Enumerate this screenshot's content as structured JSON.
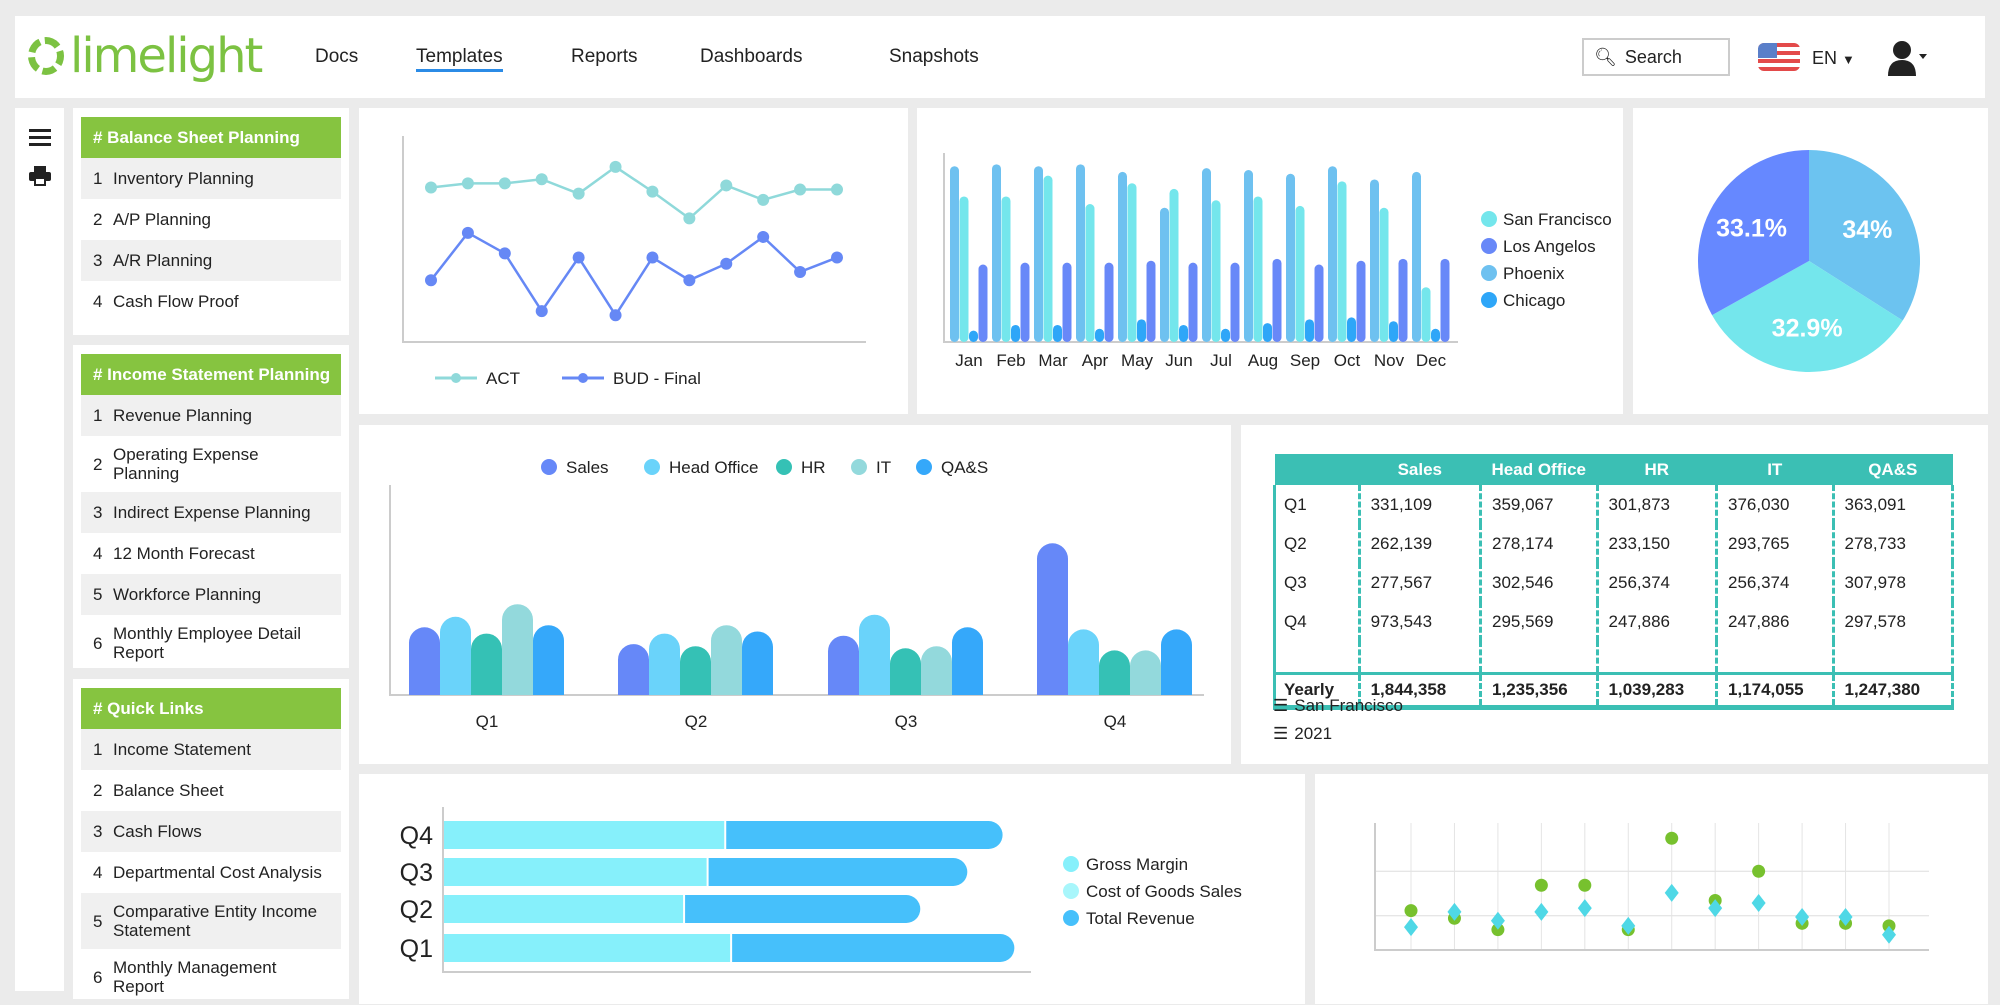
{
  "header": {
    "logo": "limelight",
    "nav": [
      "Docs",
      "Templates",
      "Reports",
      "Dashboards",
      "Snapshots"
    ],
    "active_nav": "Templates",
    "search_placeholder": "Search",
    "language": "EN"
  },
  "sidebar": {
    "panels": [
      {
        "title": "# Balance Sheet Planning",
        "items": [
          {
            "n": "1",
            "label": "Inventory Planning"
          },
          {
            "n": "2",
            "label": "A/P Planning"
          },
          {
            "n": "3",
            "label": "A/R Planning"
          },
          {
            "n": "4",
            "label": "Cash Flow Proof"
          }
        ]
      },
      {
        "title": "# Income Statement Planning",
        "items": [
          {
            "n": "1",
            "label": "Revenue Planning"
          },
          {
            "n": "2",
            "label": "Operating Expense Planning"
          },
          {
            "n": "3",
            "label": "Indirect Expense Planning"
          },
          {
            "n": "4",
            "label": "12 Month Forecast"
          },
          {
            "n": "5",
            "label": "Workforce Planning"
          },
          {
            "n": "6",
            "label": "Monthly Employee Detail Report"
          }
        ]
      },
      {
        "title": "# Quick Links",
        "items": [
          {
            "n": "1",
            "label": "Income Statement"
          },
          {
            "n": "2",
            "label": "Balance Sheet"
          },
          {
            "n": "3",
            "label": "Cash Flows"
          },
          {
            "n": "4",
            "label": "Departmental Cost Analysis"
          },
          {
            "n": "5",
            "label": "Comparative Entity Income Statement"
          },
          {
            "n": "6",
            "label": "Monthly Management Report"
          }
        ]
      }
    ]
  },
  "table": {
    "columns": [
      "",
      "Sales",
      "Head Office",
      "HR",
      "IT",
      "QA&S"
    ],
    "rows": [
      [
        "Q1",
        "331,109",
        "359,067",
        "301,873",
        "376,030",
        "363,091"
      ],
      [
        "Q2",
        "262,139",
        "278,174",
        "233,150",
        "293,765",
        "278,733"
      ],
      [
        "Q3",
        "277,567",
        "302,546",
        "256,374",
        "256,374",
        "307,978"
      ],
      [
        "Q4",
        "973,543",
        "295,569",
        "247,886",
        "247,886",
        "297,578"
      ]
    ],
    "total": [
      "Yearly",
      "1,844,358",
      "1,235,356",
      "1,039,283",
      "1,174,055",
      "1,247,380"
    ],
    "filters": [
      "San Francisco",
      "2021"
    ],
    "color": "#3bbfb4"
  },
  "chart_data": [
    {
      "type": "line",
      "x": [
        "1",
        "2",
        "3",
        "4",
        "5",
        "6",
        "7",
        "8",
        "9",
        "10",
        "11",
        "12"
      ],
      "ylim": [
        0,
        100
      ],
      "legend": "bottom",
      "series": [
        {
          "name": "ACT",
          "color": "#8fd9da",
          "values": [
            75,
            77,
            77,
            79,
            72,
            85,
            73,
            60,
            76,
            69,
            74,
            74
          ]
        },
        {
          "name": "BUD - Final",
          "color": "#6688f5",
          "values": [
            30,
            53,
            43,
            15,
            41,
            13,
            41,
            30,
            38,
            51,
            34,
            41
          ]
        }
      ]
    },
    {
      "type": "bar",
      "categories": [
        "Jan",
        "Feb",
        "Mar",
        "Apr",
        "May",
        "Jun",
        "Jul",
        "Aug",
        "Sep",
        "Oct",
        "Nov",
        "Dec"
      ],
      "ylim": [
        0,
        100
      ],
      "legend": "right",
      "series": [
        {
          "name": "Phoenix",
          "color": "#6ec1f0",
          "values": [
            93,
            94,
            93,
            94,
            90,
            71,
            92,
            91,
            89,
            93,
            86,
            90
          ]
        },
        {
          "name": "San Francisco",
          "color": "#74e6ec",
          "values": [
            77,
            77,
            88,
            73,
            84,
            81,
            75,
            77,
            72,
            85,
            71,
            29
          ]
        },
        {
          "name": "Chicago",
          "color": "#2ea6f8",
          "values": [
            6,
            9,
            9,
            7,
            12,
            9,
            7,
            10,
            12,
            13,
            11,
            7
          ]
        },
        {
          "name": "Los Angelos",
          "color": "#6888f8",
          "values": [
            41,
            42,
            42,
            42,
            43,
            42,
            42,
            44,
            41,
            43,
            44,
            44
          ]
        }
      ],
      "legend_order": [
        "San Francisco",
        "Los Angelos",
        "Phoenix",
        "Chicago"
      ]
    },
    {
      "type": "pie",
      "slices": [
        {
          "label": "34%",
          "value": 34,
          "color": "#6cc3f0"
        },
        {
          "label": "32.9%",
          "value": 32.9,
          "color": "#74e6ec"
        },
        {
          "label": "33.1%",
          "value": 33.1,
          "color": "#6688ff"
        }
      ]
    },
    {
      "type": "bar",
      "categories": [
        "Q1",
        "Q2",
        "Q3",
        "Q4"
      ],
      "ylim": [
        0,
        100
      ],
      "legend": "top",
      "series": [
        {
          "name": "Sales",
          "color": "#6688f8",
          "values": [
            32,
            24,
            28,
            72
          ]
        },
        {
          "name": "Head Office",
          "color": "#6ad3fa",
          "values": [
            37,
            29,
            38,
            31
          ]
        },
        {
          "name": "HR",
          "color": "#35c1b5",
          "values": [
            29,
            23,
            22,
            21
          ]
        },
        {
          "name": "IT",
          "color": "#93d9dc",
          "values": [
            43,
            33,
            23,
            21
          ]
        },
        {
          "name": "QA&S",
          "color": "#35a8fa",
          "values": [
            33,
            30,
            32,
            31
          ]
        }
      ]
    },
    {
      "type": "bar",
      "orientation": "horizontal",
      "stacked": true,
      "categories": [
        "Q1",
        "Q2",
        "Q3",
        "Q4"
      ],
      "xlim": [
        0,
        100
      ],
      "legend": "right",
      "series": [
        {
          "name": "Gross Margin",
          "color": "#86f0fb",
          "values": [
            49,
            41,
            45,
            48
          ]
        },
        {
          "name": "Cost of Goods Sales",
          "color": "#a8f6fb",
          "values": [
            0,
            0,
            0,
            0
          ]
        },
        {
          "name": "Total Revenue",
          "color": "#46c0fb",
          "values": [
            48,
            40,
            44,
            47
          ]
        }
      ]
    },
    {
      "type": "scatter",
      "x": [
        1,
        2,
        3,
        4,
        5,
        6,
        7,
        8,
        9,
        10,
        11,
        12
      ],
      "ylim": [
        0,
        100
      ],
      "grid": true,
      "series": [
        {
          "marker": "circle",
          "color": "#77c12e",
          "values": [
            31,
            25,
            16,
            51,
            51,
            16,
            88,
            39,
            62,
            21,
            21,
            19
          ]
        },
        {
          "marker": "diamond",
          "color": "#4fd8e6",
          "values": [
            18,
            30,
            23,
            30,
            33,
            19,
            45,
            33,
            37,
            26,
            26,
            12
          ]
        }
      ]
    }
  ]
}
